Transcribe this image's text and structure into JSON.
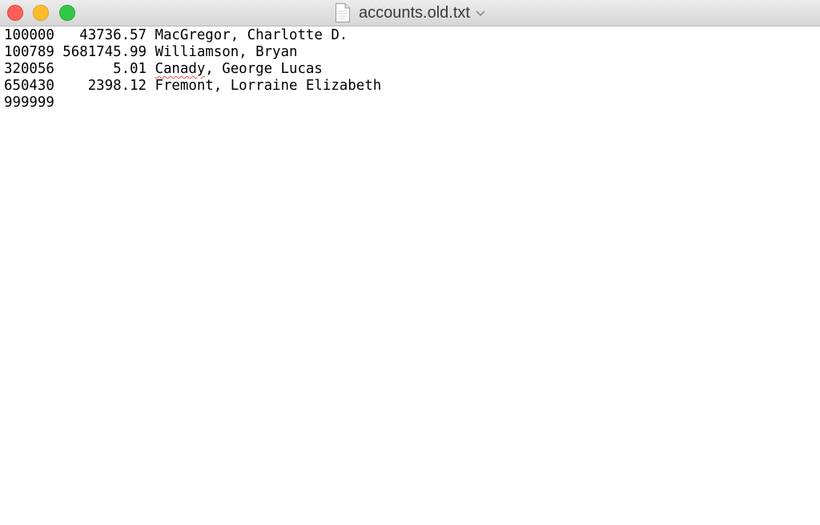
{
  "window": {
    "title": "accounts.old.txt",
    "file_icon": "document-icon",
    "title_menu_icon": "chevron-down-icon",
    "controls": {
      "close_color": "#fc5f57",
      "minimize_color": "#fdbc2e",
      "zoom_color": "#33c748"
    }
  },
  "document": {
    "lines": [
      {
        "account": "100000",
        "balance": "43736.57",
        "name_misspelled": "",
        "name_rest": "MacGregor, Charlotte D."
      },
      {
        "account": "100789",
        "balance": "5681745.99",
        "name_misspelled": "",
        "name_rest": "Williamson, Bryan"
      },
      {
        "account": "320056",
        "balance": "5.01",
        "name_misspelled": "Canady",
        "name_rest": ", George Lucas"
      },
      {
        "account": "650430",
        "balance": "2398.12",
        "name_misspelled": "",
        "name_rest": "Fremont, Lorraine Elizabeth"
      },
      {
        "account": "999999",
        "balance": "",
        "name_misspelled": "",
        "name_rest": ""
      }
    ]
  }
}
